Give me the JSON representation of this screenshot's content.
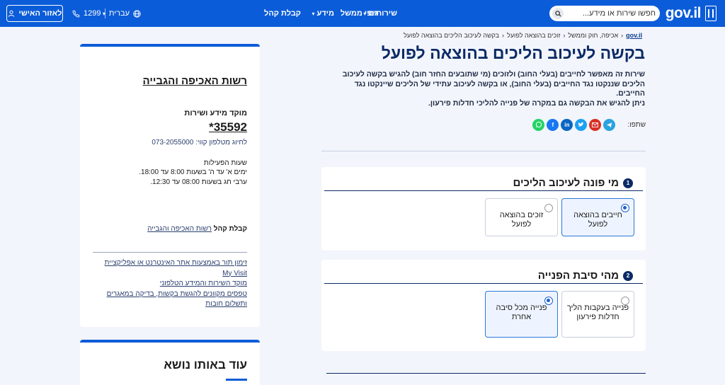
{
  "header": {
    "brand": "gov.il",
    "search_placeholder": "חפשו שירות או מידע...",
    "nav": {
      "services": "שירותים",
      "gov_body": "גופי ממשל",
      "info": "מידע",
      "public_reception": "קבלת קהל"
    },
    "language": "עברית",
    "phone": "1299",
    "login": "לאזור האישי"
  },
  "breadcrumb": {
    "home": "gov.il",
    "items": [
      "אכיפה, חוק וממשל",
      "זוכים בהוצאה לפועל",
      "בקשה לעיכוב הליכים בהוצאה לפועל"
    ],
    "sep": "‹"
  },
  "page": {
    "title": "בקשה לעיכוב הליכים בהוצאה לפועל",
    "intro_1": "שירות זה מאפשר לחייבים (בעלי החוב) ולזוכים (מי שתובעים החזר חוב) להגיש בקשה לעיכוב הליכים שננקטו נגד החייבים (בעלי החוב), או בקשה לעיכוב עתידי של הליכים שיינקטו נגד החייבים.",
    "intro_2": "ניתן להגיש את הבקשה גם במקרה של פנייה להליכי חדלות פירעון.",
    "share_label": "שתפו:"
  },
  "q1": {
    "num": "1",
    "title": "מי פונה לעיכוב הליכים",
    "opt_a": "חייבים בהוצאה לפועל",
    "opt_b": "זוכים בהוצאה לפועל",
    "selected": "opt_a"
  },
  "q2": {
    "num": "2",
    "title": "מהי סיבת הפנייה",
    "opt_a": "פנייה בעקבות הליך חדלות פירעון",
    "opt_b": "פנייה מכל סיבה אחרת",
    "selected": "opt_b"
  },
  "sidebar": {
    "title": "רשות האכיפה והגבייה",
    "info_center": "מוקד מידע ושירות",
    "phone_short": "*35592",
    "landline": "לחיוג מטלפון קווי: 073-2055000",
    "hours_title": "שעות הפעילות",
    "hours_1": "ימים א' עד ה' בשעות 8:00 עד 18:00.",
    "hours_2": "ערבי חג בשעות 08:00 עד 12:30.",
    "reception_label": "קבלת קהל",
    "reception_link": "רשות האכיפה והגבייה",
    "links": [
      "זימון תור באמצעות אתר האינטרנט או אפליקציית My Visit",
      "מוקד השירות והמידע הטלפוני",
      "טפסים מקוונים להגשת בקשות, בדיקה במאגרים ותשלום חובות"
    ],
    "more_title": "עוד באותו נושא"
  },
  "colors": {
    "header": "#0b5cd8",
    "title": "#0b2a66",
    "whatsapp": "#25d366",
    "facebook": "#1877f2",
    "linkedin": "#0a66c2",
    "twitter": "#1da1f2",
    "email": "#d93025",
    "telegram": "#2aa3e0"
  }
}
